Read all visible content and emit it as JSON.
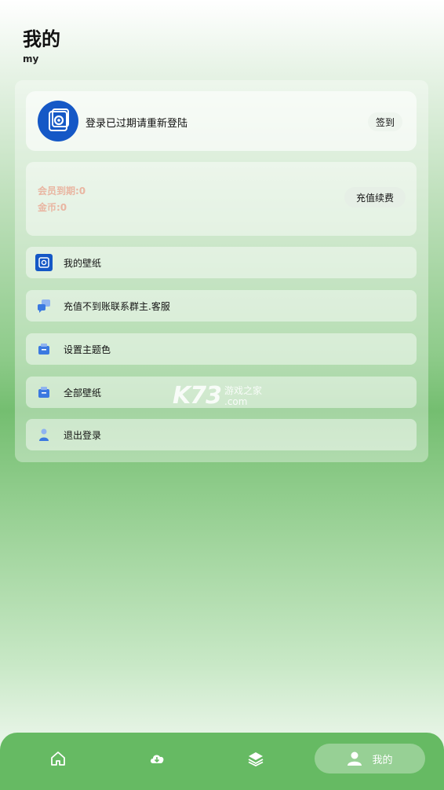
{
  "header": {
    "title": "我的",
    "subtitle": "my"
  },
  "user": {
    "status": "登录已过期请重新登陆",
    "signin_label": "签到"
  },
  "vip": {
    "expire": "会员到期:0",
    "coins": "金币:0",
    "recharge_label": "充值续费"
  },
  "menu": [
    {
      "label": "我的壁纸",
      "icon": "gallery-icon"
    },
    {
      "label": "充值不到账联系群主.客服",
      "icon": "chat-icon"
    },
    {
      "label": "设置主题色",
      "icon": "palette-icon"
    },
    {
      "label": "全部壁纸",
      "icon": "folder-icon"
    },
    {
      "label": "退出登录",
      "icon": "user-icon"
    }
  ],
  "watermark": {
    "brand": "K73",
    "line1": "游戏之家",
    "line2": ".com"
  },
  "tabbar": {
    "items": [
      {
        "icon": "home-icon"
      },
      {
        "icon": "cloud-download-icon"
      },
      {
        "icon": "layers-icon"
      },
      {
        "icon": "person-icon",
        "label": "我的",
        "active": true
      }
    ]
  },
  "colors": {
    "accent": "#66ba63",
    "avatar_bg": "#1558c6",
    "vip_text": "#e9b6a2"
  }
}
